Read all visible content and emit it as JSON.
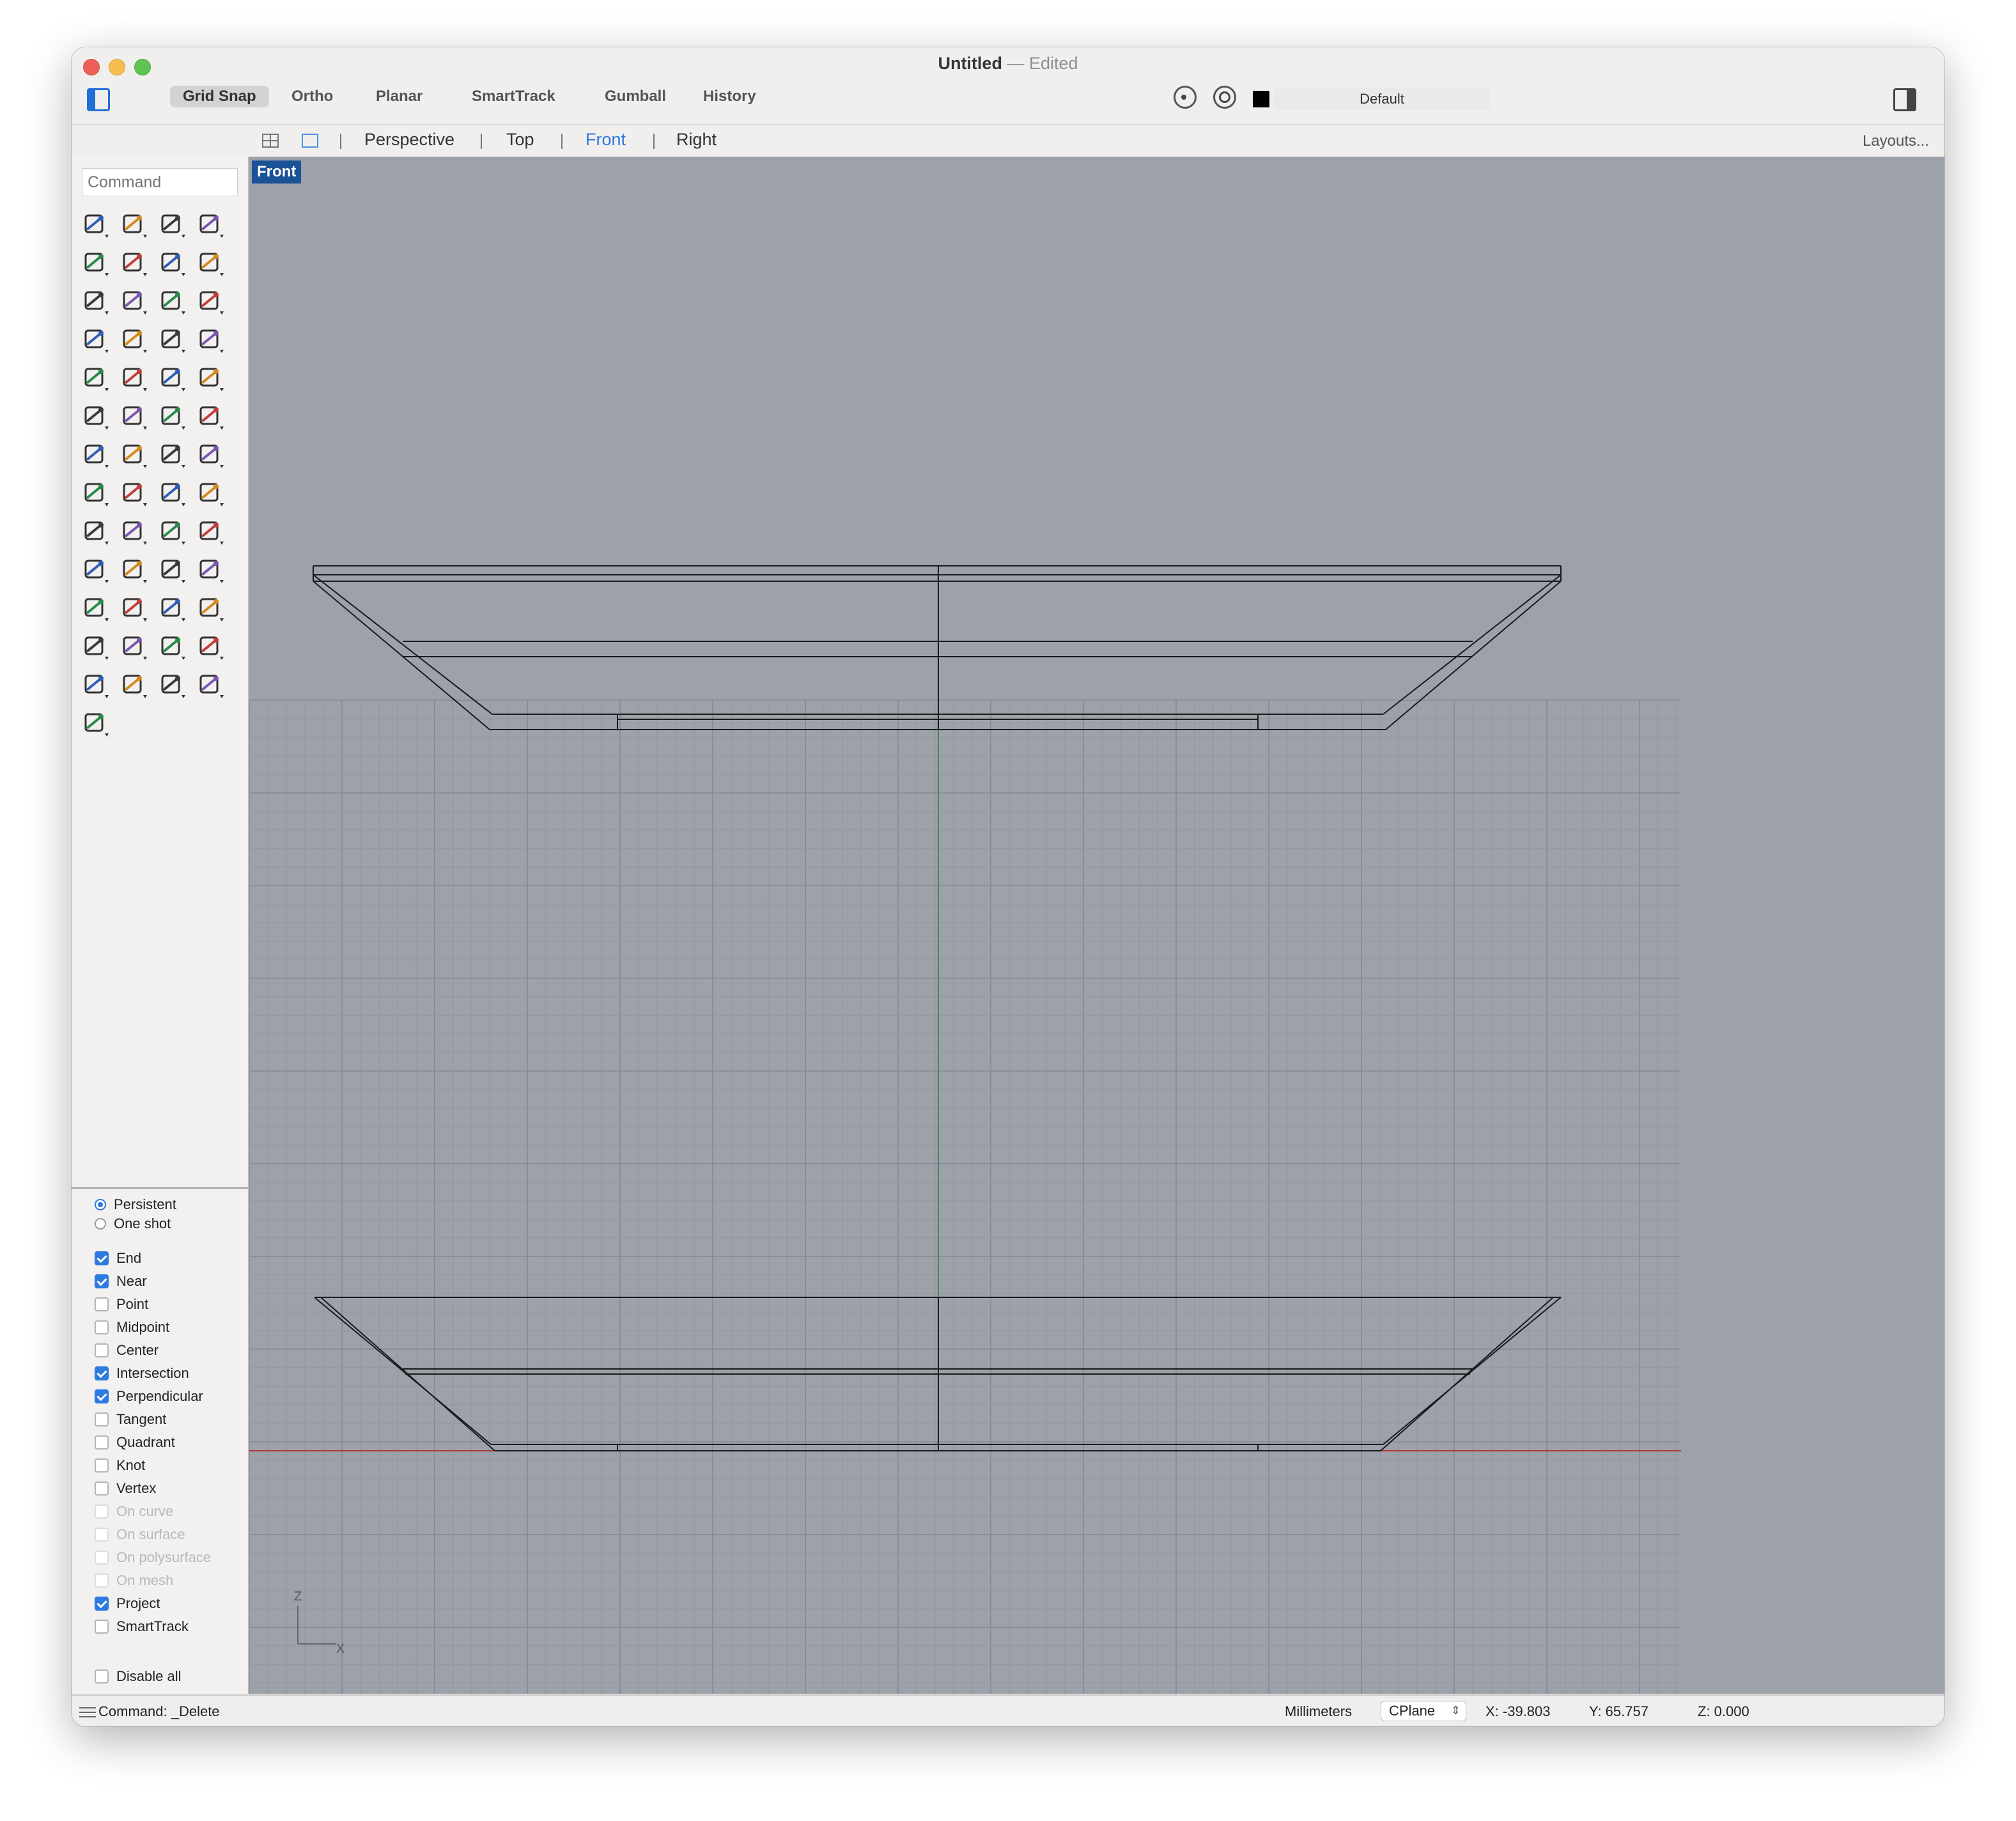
{
  "window": {
    "title": "Untitled",
    "separator": "—",
    "status": "Edited"
  },
  "toolbar": {
    "modes": [
      {
        "label": "Grid Snap",
        "active": true
      },
      {
        "label": "Ortho",
        "active": false
      },
      {
        "label": "Planar",
        "active": false
      },
      {
        "label": "SmartTrack",
        "active": false
      },
      {
        "label": "Gumball",
        "active": false
      },
      {
        "label": "History",
        "active": false
      }
    ],
    "layer": {
      "name": "Default",
      "color": "#000000"
    }
  },
  "viewport_tabs": {
    "tabs": [
      "Perspective",
      "Top",
      "Front",
      "Right"
    ],
    "active": "Front",
    "layouts_label": "Layouts..."
  },
  "command": {
    "placeholder": "Command"
  },
  "toolbox_icons": [
    "select-arrow-icon",
    "point-icon",
    "polyline-icon",
    "curve-icon",
    "circle-icon",
    "ellipse-icon",
    "arc-icon",
    "rectangle-icon",
    "polygon-icon",
    "fillet-curve-icon",
    "surface-patch-icon",
    "loft-icon",
    "box-icon",
    "sphere-icon",
    "cylinder-icon",
    "mesh-plane-icon",
    "explode-icon",
    "split-icon",
    "trim-icon",
    "extend-icon",
    "boolean-union-icon",
    "boolean-split-icon",
    "join-icon",
    "offset-icon",
    "text-icon",
    "move-icon",
    "array-icon",
    "mirror-icon",
    "solid-edit-icon",
    "dimension-icon",
    "grid-array-icon",
    "align-icon",
    "analyze-icon",
    "check-icon",
    "surface-analysis-icon",
    "curvature-icon",
    "zoom-icon",
    "zoom-window-icon",
    "zoom-extents-icon",
    "zoom-selected-icon",
    "rotate-view-icon",
    "car-render-icon",
    "grid-plane-icon",
    "transform-icon",
    "light-icon",
    "lock-icon",
    "material-icon",
    "color-wheel-icon",
    "wireframe-sphere-icon",
    "shaded-sphere-icon",
    "rendered-sphere-icon",
    "tag-icon",
    "cplane-icon"
  ],
  "osnap": {
    "mode_options": [
      {
        "label": "Persistent",
        "selected": true
      },
      {
        "label": "One shot",
        "selected": false
      }
    ],
    "snaps": [
      {
        "label": "End",
        "checked": true,
        "enabled": true
      },
      {
        "label": "Near",
        "checked": true,
        "enabled": true
      },
      {
        "label": "Point",
        "checked": false,
        "enabled": true
      },
      {
        "label": "Midpoint",
        "checked": false,
        "enabled": true
      },
      {
        "label": "Center",
        "checked": false,
        "enabled": true
      },
      {
        "label": "Intersection",
        "checked": true,
        "enabled": true
      },
      {
        "label": "Perpendicular",
        "checked": true,
        "enabled": true
      },
      {
        "label": "Tangent",
        "checked": false,
        "enabled": true
      },
      {
        "label": "Quadrant",
        "checked": false,
        "enabled": true
      },
      {
        "label": "Knot",
        "checked": false,
        "enabled": true
      },
      {
        "label": "Vertex",
        "checked": false,
        "enabled": true
      },
      {
        "label": "On curve",
        "checked": false,
        "enabled": false
      },
      {
        "label": "On surface",
        "checked": false,
        "enabled": false
      },
      {
        "label": "On polysurface",
        "checked": false,
        "enabled": false
      },
      {
        "label": "On mesh",
        "checked": false,
        "enabled": false
      },
      {
        "label": "Project",
        "checked": true,
        "enabled": true
      },
      {
        "label": "SmartTrack",
        "checked": false,
        "enabled": true
      }
    ],
    "disable_all": {
      "label": "Disable all",
      "checked": false
    }
  },
  "viewport": {
    "name": "Front",
    "axis_labels": {
      "z": "Z",
      "x": "X"
    },
    "background": "#9ca1aa",
    "grid_minor": "#8f959e",
    "grid_major": "#848a93",
    "x_axis_color": "#b03a3a",
    "z_axis_color": "#3f8a4d"
  },
  "status": {
    "command": "Command: _Delete",
    "units": "Millimeters",
    "cplane": "CPlane",
    "x": "X: -39.803",
    "y": "Y: 65.757",
    "z": "Z: 0.000"
  }
}
